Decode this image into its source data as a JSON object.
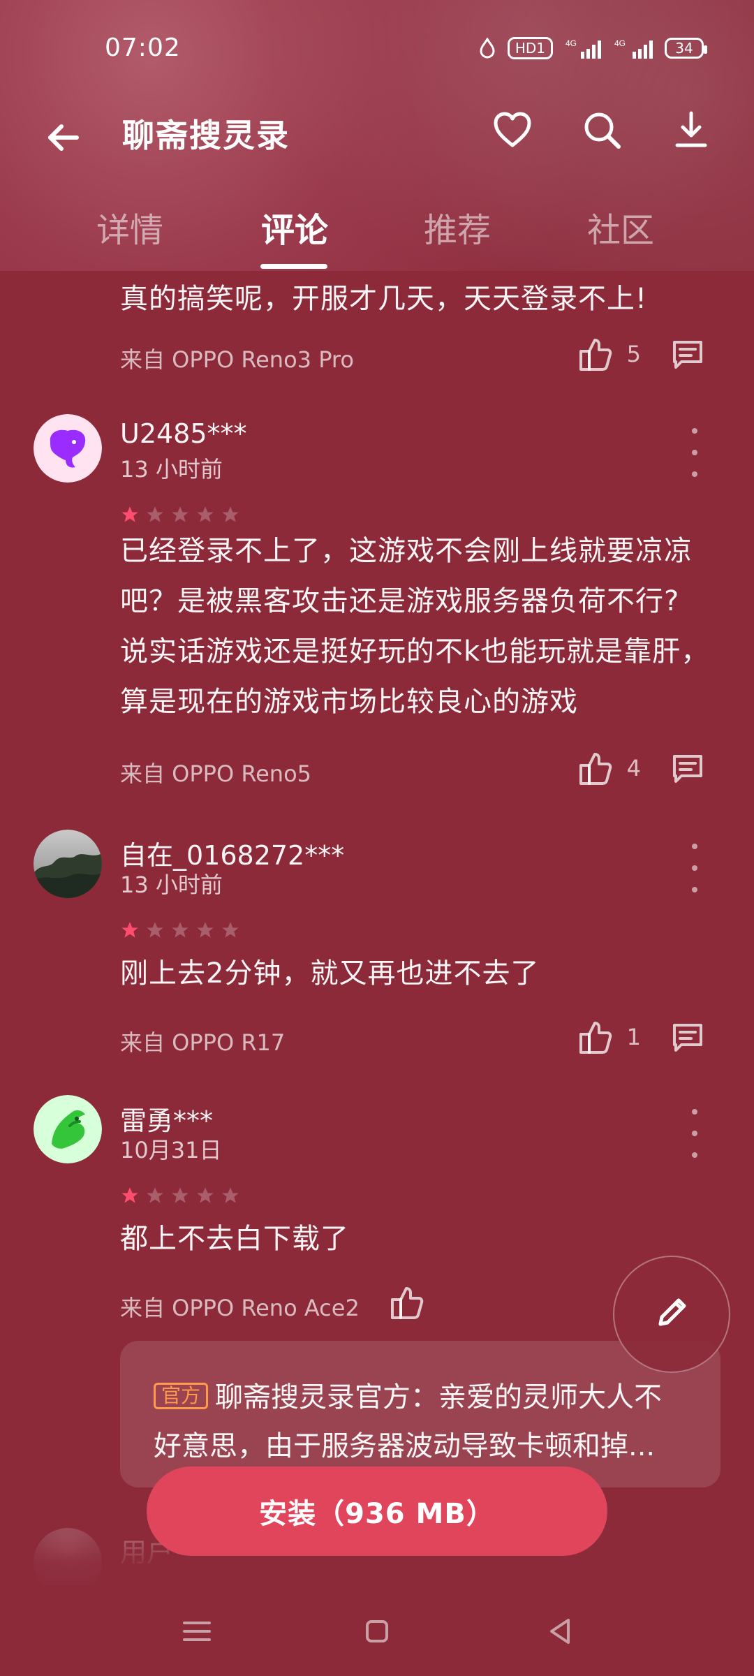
{
  "status_bar": {
    "time": "07:02",
    "hd_label": "HD1",
    "net1": "4G",
    "net2": "4G",
    "battery": "34"
  },
  "app_bar": {
    "title": "聊斋搜灵录"
  },
  "tabs": [
    {
      "label": "详情"
    },
    {
      "label": "评论",
      "active": true
    },
    {
      "label": "推荐"
    },
    {
      "label": "社区"
    }
  ],
  "reviews": [
    {
      "text": "真的搞笑呢，开服才几天，天天登录不上!",
      "device": "来自 OPPO Reno3 Pro",
      "likes": "5"
    },
    {
      "user": "U2485***",
      "time": "13 小时前",
      "rating": 1,
      "text_lines": [
        "已经登录不上了，这游戏不会刚上线就要凉凉",
        "吧？是被黑客攻击还是游戏服务器负荷不行?",
        "说实话游戏还是挺好玩的不k也能玩就是靠肝，",
        "算是现在的游戏市场比较良心的游戏"
      ],
      "device": "来自 OPPO Reno5",
      "likes": "4"
    },
    {
      "user": "自在_0168272***",
      "time": "13 小时前",
      "rating": 1,
      "text": "刚上去2分钟，就又再也进不去了",
      "device": "来自 OPPO R17",
      "likes": "1"
    },
    {
      "user": "雷勇***",
      "time": "10月31日",
      "rating": 1,
      "text": "都上不去白下载了",
      "device": "来自 OPPO Reno Ace2",
      "official_reply": {
        "tag": "官方",
        "line1": "聊斋搜灵录官方：亲爱的灵师大人不",
        "line2": "好意思，由于服务器波动导致卡顿和掉..."
      }
    }
  ],
  "partial_next": {
    "user": "用户"
  },
  "install_button": "安装（936 MB）",
  "colors": {
    "background": "#8c2a3a",
    "accent": "#e1455c",
    "star_active": "#ff4d6d",
    "official_tag": "#ff9a4a"
  },
  "icons": {
    "back": "back-arrow-icon",
    "favorite": "heart-icon",
    "search": "search-icon",
    "download": "download-icon",
    "like": "thumb-up-icon",
    "reply": "comment-icon",
    "more": "more-vertical-icon",
    "edit": "pencil-icon",
    "nav_menu": "menu-icon",
    "nav_home": "home-square-icon",
    "nav_back": "triangle-back-icon"
  }
}
